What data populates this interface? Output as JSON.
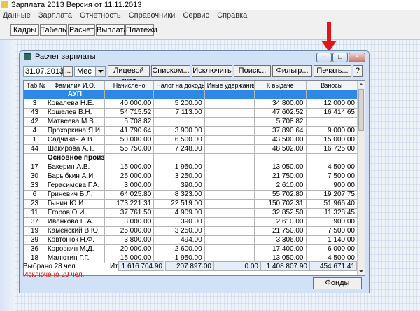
{
  "app": {
    "title": "Зарплата 2013 Версия от 11.11.2013",
    "menu": [
      "Данные",
      "Зарплата",
      "Отчетность",
      "Справочники",
      "Сервис",
      "Справка"
    ],
    "toolbar": [
      "Кадры",
      "Табель",
      "Расчет",
      "Выплата",
      "Платежи"
    ]
  },
  "window": {
    "title": "Расчет зарплаты",
    "date": "31.07.2013",
    "dots_button": "...",
    "period": "Мес",
    "buttons": {
      "account": "Лицевой счет",
      "list": "Списком...",
      "exclude": "Исключить",
      "search": "Поиск...",
      "filter": "Фильтр...",
      "print": "Печать...",
      "help": "?"
    },
    "fondy": "Фонды"
  },
  "table": {
    "headers": [
      "Таб.№",
      "Фамилия И.О.",
      "Начислено",
      "Налог на доходы",
      "Иные удержания",
      "К выдаче",
      "Взносы"
    ],
    "rows": [
      {
        "type": "selected",
        "name": "АУП"
      },
      {
        "tab": "3",
        "name": "Ковалева Н.Е.",
        "accrued": "40 000.00",
        "tax": "5 200.00",
        "other": "",
        "payout": "34 800.00",
        "contrib": "12 000.00"
      },
      {
        "tab": "43",
        "name": "Кошелев В.Н.",
        "accrued": "54 715.52",
        "tax": "7 113.00",
        "other": "",
        "payout": "47 602.52",
        "contrib": "16 414.65"
      },
      {
        "tab": "42",
        "name": "Матвеева М.В.",
        "accrued": "5 708.82",
        "tax": "",
        "other": "",
        "payout": "5 708.82",
        "contrib": ""
      },
      {
        "tab": "4",
        "name": "Прохоркина Я.И.",
        "accrued": "41 790.64",
        "tax": "3 900.00",
        "other": "",
        "payout": "37 890.64",
        "contrib": "9 000.00"
      },
      {
        "tab": "1",
        "name": "Садчикин А.В.",
        "accrued": "50 000.00",
        "tax": "6 500.00",
        "other": "",
        "payout": "43 500.00",
        "contrib": "15 000.00"
      },
      {
        "tab": "44",
        "name": "Шакирова А.Т.",
        "accrued": "55 750.00",
        "tax": "7 248.00",
        "other": "",
        "payout": "48 502.00",
        "contrib": "16 725.00"
      },
      {
        "type": "group",
        "name": "Основное производ"
      },
      {
        "tab": "17",
        "name": "Бакерин А.В.",
        "accrued": "15 000.00",
        "tax": "1 950.00",
        "other": "",
        "payout": "13 050.00",
        "contrib": "4 500.00"
      },
      {
        "tab": "30",
        "name": "Барыбкин А.И.",
        "accrued": "25 000.00",
        "tax": "3 250.00",
        "other": "",
        "payout": "21 750.00",
        "contrib": "7 500.00"
      },
      {
        "tab": "33",
        "name": "Герасимова Г.А.",
        "accrued": "3 000.00",
        "tax": "390.00",
        "other": "",
        "payout": "2 610.00",
        "contrib": "900.00"
      },
      {
        "tab": "6",
        "name": "Гриневич Б.Л.",
        "accrued": "64 025.80",
        "tax": "8 323.00",
        "other": "",
        "payout": "55 702.80",
        "contrib": "19 207.75"
      },
      {
        "tab": "23",
        "name": "Гынин Ю.И.",
        "accrued": "173 221.31",
        "tax": "22 519.00",
        "other": "",
        "payout": "150 702.31",
        "contrib": "51 966.40"
      },
      {
        "tab": "11",
        "name": "Егоров О.И.",
        "accrued": "37 761.50",
        "tax": "4 909.00",
        "other": "",
        "payout": "32 852.50",
        "contrib": "11 328.45"
      },
      {
        "tab": "37",
        "name": "Иванкова Е.А.",
        "accrued": "3 000.00",
        "tax": "390.00",
        "other": "",
        "payout": "2 610.00",
        "contrib": "900.00"
      },
      {
        "tab": "19",
        "name": "Каменский В.Ю.",
        "accrued": "25 000.00",
        "tax": "3 250.00",
        "other": "",
        "payout": "21 750.00",
        "contrib": "7 500.00"
      },
      {
        "tab": "39",
        "name": "Ковтонюк Н.Ф.",
        "accrued": "3 800.00",
        "tax": "494.00",
        "other": "",
        "payout": "3 306.00",
        "contrib": "1 140.00"
      },
      {
        "tab": "36",
        "name": "Коровкин М.Д.",
        "accrued": "20 000.00",
        "tax": "2 600.00",
        "other": "",
        "payout": "17 400.00",
        "contrib": "6 000.00"
      },
      {
        "tab": "18",
        "name": "Малютин Г.Г.",
        "accrued": "15 000.00",
        "tax": "1 950.00",
        "other": "",
        "payout": "13 050.00",
        "contrib": "4 500.00"
      }
    ]
  },
  "footer": {
    "selected": "Выбрано 28 чел.",
    "excluded": "Исключено 29 чел.",
    "total_label": "Итого:",
    "total_accrued": "1 616 704.90",
    "total_tax": "207 897.00",
    "total_other": "0.00",
    "total_payout": "1 408 807.90",
    "total_contrib": "454 671.41"
  },
  "colors": {
    "selection": "#2e89e6",
    "arrow": "#e0161b",
    "excluded_text": "#d11010"
  }
}
